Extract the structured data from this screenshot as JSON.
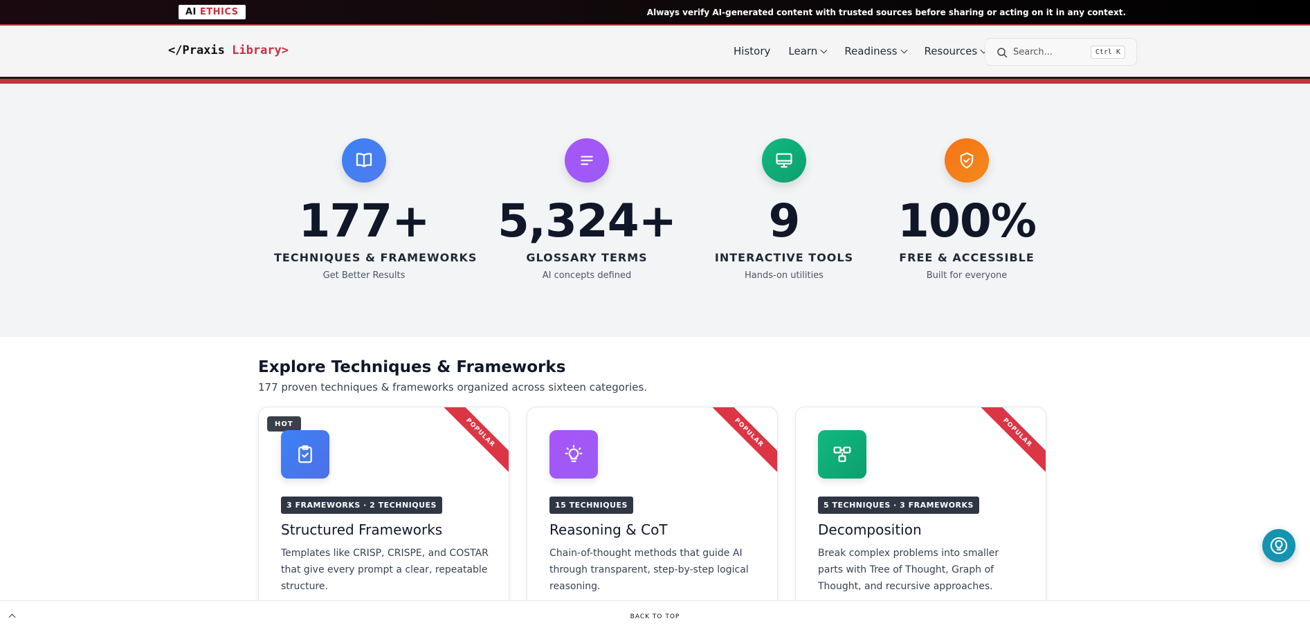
{
  "topbar": {
    "badge_ai": "AI",
    "badge_ethics": "ETHICS",
    "message": "Always verify AI-generated content with trusted sources before sharing or acting on it in any context."
  },
  "header": {
    "logo_prefix": "</Praxis",
    "logo_accent": "Library>",
    "nav": [
      {
        "label": "History",
        "dropdown": false
      },
      {
        "label": "Learn",
        "dropdown": true
      },
      {
        "label": "Readiness",
        "dropdown": true
      },
      {
        "label": "Resources",
        "dropdown": true
      }
    ],
    "search": {
      "placeholder": "Search...",
      "shortcut": "Ctrl K"
    }
  },
  "stats": [
    {
      "icon": "book-icon",
      "color": "#3b82f6",
      "value": "177+",
      "label": "TECHNIQUES & FRAMEWORKS",
      "sub": "Get Better Results"
    },
    {
      "icon": "lines-icon",
      "color": "#a855f7",
      "value": "5,324+",
      "label": "GLOSSARY TERMS",
      "sub": "AI concepts defined"
    },
    {
      "icon": "monitor-icon",
      "color": "#10b981",
      "value": "9",
      "label": "INTERACTIVE TOOLS",
      "sub": "Hands-on utilities"
    },
    {
      "icon": "shield-check-icon",
      "color": "#f97316",
      "value": "100%",
      "label": "FREE & ACCESSIBLE",
      "sub": "Built for everyone"
    }
  ],
  "explore": {
    "title": "Explore Techniques & Frameworks",
    "subtitle": "177 proven techniques & frameworks organized across sixteen categories."
  },
  "cards": [
    {
      "hot": "HOT",
      "ribbon": "POPULAR",
      "icon": "clipboard-check-icon",
      "color": "#3b82f6",
      "pill": "3 FRAMEWORKS · 2 TECHNIQUES",
      "title": "Structured Frameworks",
      "desc": "Templates like CRISP, CRISPE, and COSTAR that give every prompt a clear, repeatable structure."
    },
    {
      "ribbon": "POPULAR",
      "icon": "lightbulb-icon",
      "color": "#a855f7",
      "pill": "15 TECHNIQUES",
      "title": "Reasoning & CoT",
      "desc": "Chain-of-thought methods that guide AI through transparent, step-by-step logical reasoning."
    },
    {
      "ribbon": "POPULAR",
      "icon": "blocks-icon",
      "color": "#10b981",
      "pill": "5 TECHNIQUES · 3 FRAMEWORKS",
      "title": "Decomposition",
      "desc": "Break complex problems into smaller parts with Tree of Thought, Graph of Thought, and recursive approaches."
    }
  ],
  "fab": {
    "icon": "lightbulb-help-icon",
    "color": "#1494b0"
  },
  "footer": {
    "back_to_top": "BACK TO TOP"
  }
}
